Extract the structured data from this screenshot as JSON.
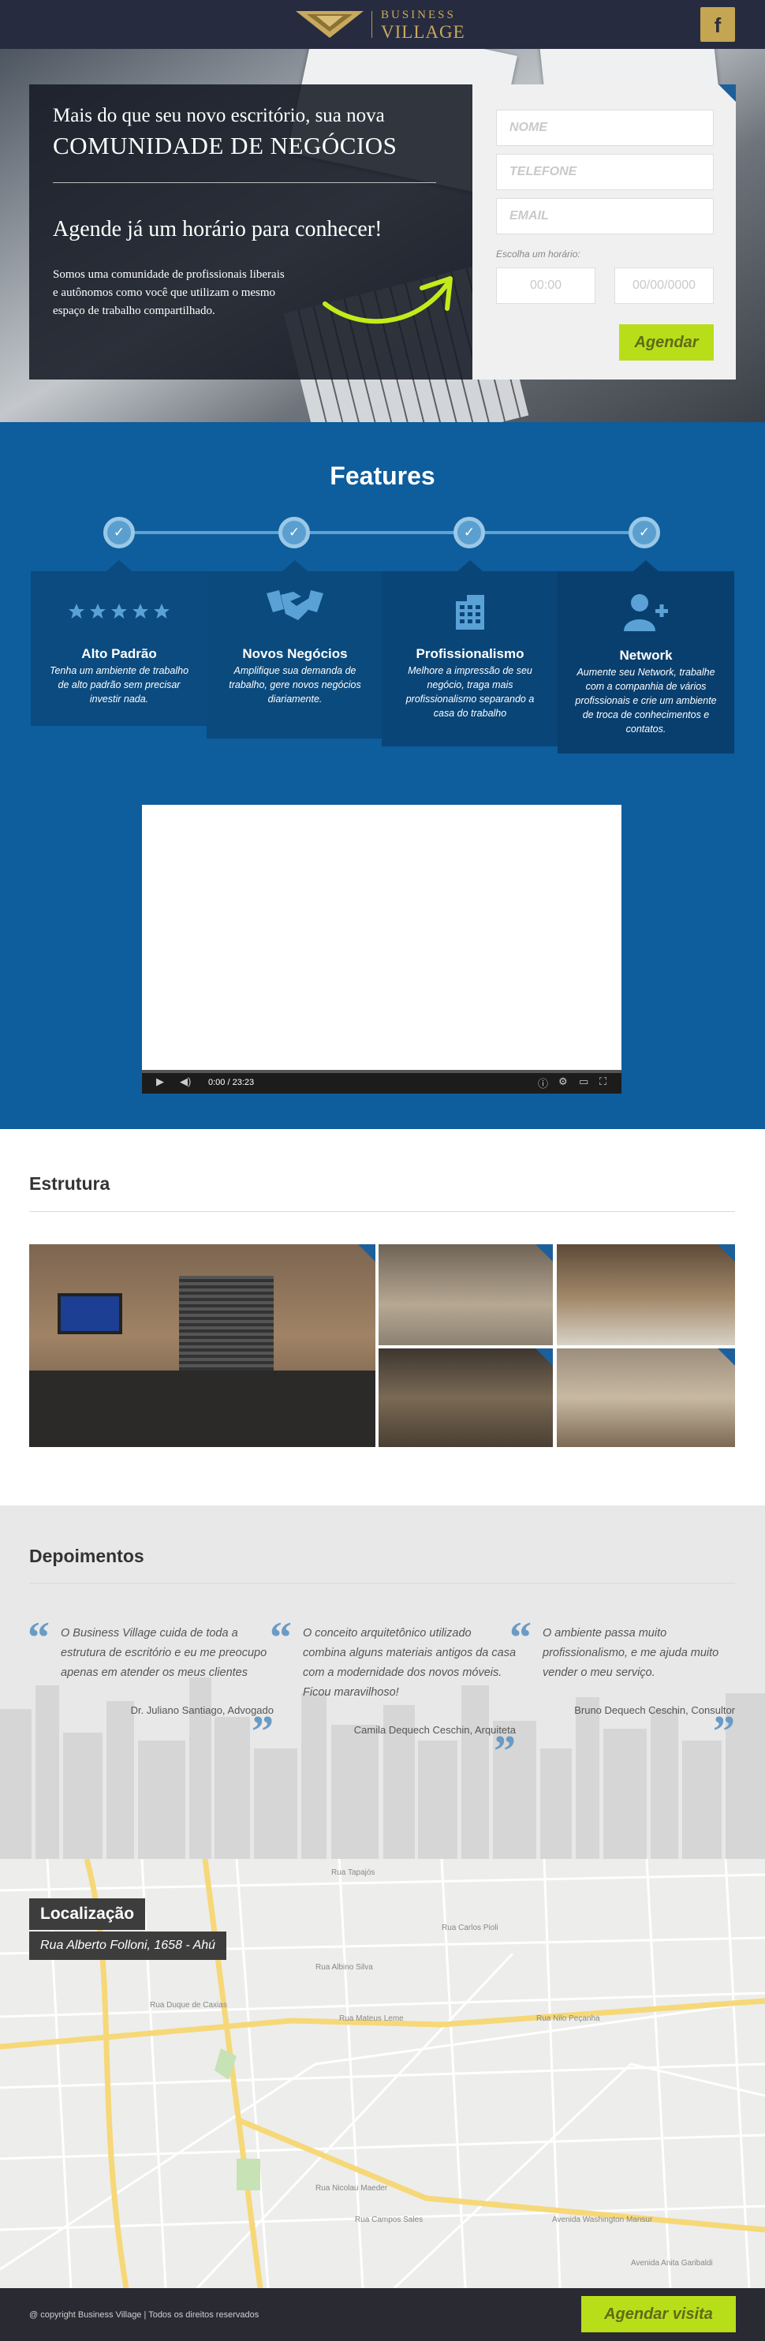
{
  "header": {
    "logo_line1": "BUSINESS",
    "logo_line2": "VILLAGE",
    "facebook_icon": "f"
  },
  "hero": {
    "line1": "Mais do que seu novo escritório, sua nova",
    "line2": "COMUNIDADE DE NEGÓCIOS",
    "line3": "Agende já um horário para conhecer!",
    "description": "Somos uma comunidade de profissionais liberais e autônomos como você que utilizam o mesmo espaço de trabalho compartilhado."
  },
  "form": {
    "name_placeholder": "NOME",
    "phone_placeholder": "TELEFONE",
    "email_placeholder": "EMAIL",
    "schedule_label": "Escolha um horário:",
    "time_placeholder": "00:00",
    "date_placeholder": "00/00/0000",
    "submit_label": "Agendar"
  },
  "features": {
    "title": "Features",
    "check_icon": "✓",
    "items": [
      {
        "title": "Alto Padrão",
        "text": "Tenha um ambiente de trabalho de alto padrão sem precisar investir nada.",
        "icon": "stars-icon"
      },
      {
        "title": "Novos Negócios",
        "text": "Amplifique sua demanda de trabalho, gere novos negócios diariamente.",
        "icon": "handshake-icon"
      },
      {
        "title": "Profissionalismo",
        "text": "Melhore a impressão de seu negócio, traga mais profissionalismo separando a casa do trabalho",
        "icon": "building-icon"
      },
      {
        "title": "Network",
        "text": "Aumente seu Network, trabalhe com a companhia de vários profissionais e crie um ambiente de troca de conhecimentos e contatos.",
        "icon": "add-user-icon"
      }
    ],
    "colors": [
      "#0b4b7f",
      "#0b4a7c",
      "#0a4577",
      "#093f6e"
    ]
  },
  "video": {
    "time": "0:00 / 23:23"
  },
  "estrutura": {
    "title": "Estrutura"
  },
  "depoimentos": {
    "title": "Depoimentos",
    "quotes": [
      {
        "text": "O Business Village cuida de toda a estrutura de escritório e eu me preocupo apenas em atender os meus clientes",
        "author": "Dr. Juliano Santiago,  Advogado"
      },
      {
        "text": "O conceito arquitetônico utilizado combina alguns materiais antigos da casa com a modernidade dos novos móveis. Ficou maravilhoso!",
        "author": "Camila Dequech Ceschin,  Arquiteta"
      },
      {
        "text": "O ambiente passa muito profissionalismo, e me ajuda muito vender o meu serviço.",
        "author": "Bruno Dequech Ceschin, Consultor"
      }
    ],
    "quote_open": "“",
    "quote_close": "”"
  },
  "map": {
    "title": "Localização",
    "address": "Rua Alberto Folloni, 1658 - Ahú",
    "streets": [
      "Rua Nilo Peçanha",
      "Rua Mateus Leme",
      "Rua Albino Silva",
      "Rua Duque de Caxias",
      "Rua Tapajós",
      "Rua Campos Sales",
      "Avenida Washington Mansur",
      "Avenida Anita Garibaldi",
      "Rua Nicolau Maeder",
      "Rua Carlos Pioli"
    ]
  },
  "footer": {
    "copyright": "@ copyright Business Village | Todos os direitos reservados",
    "cta": "Agendar visita"
  }
}
